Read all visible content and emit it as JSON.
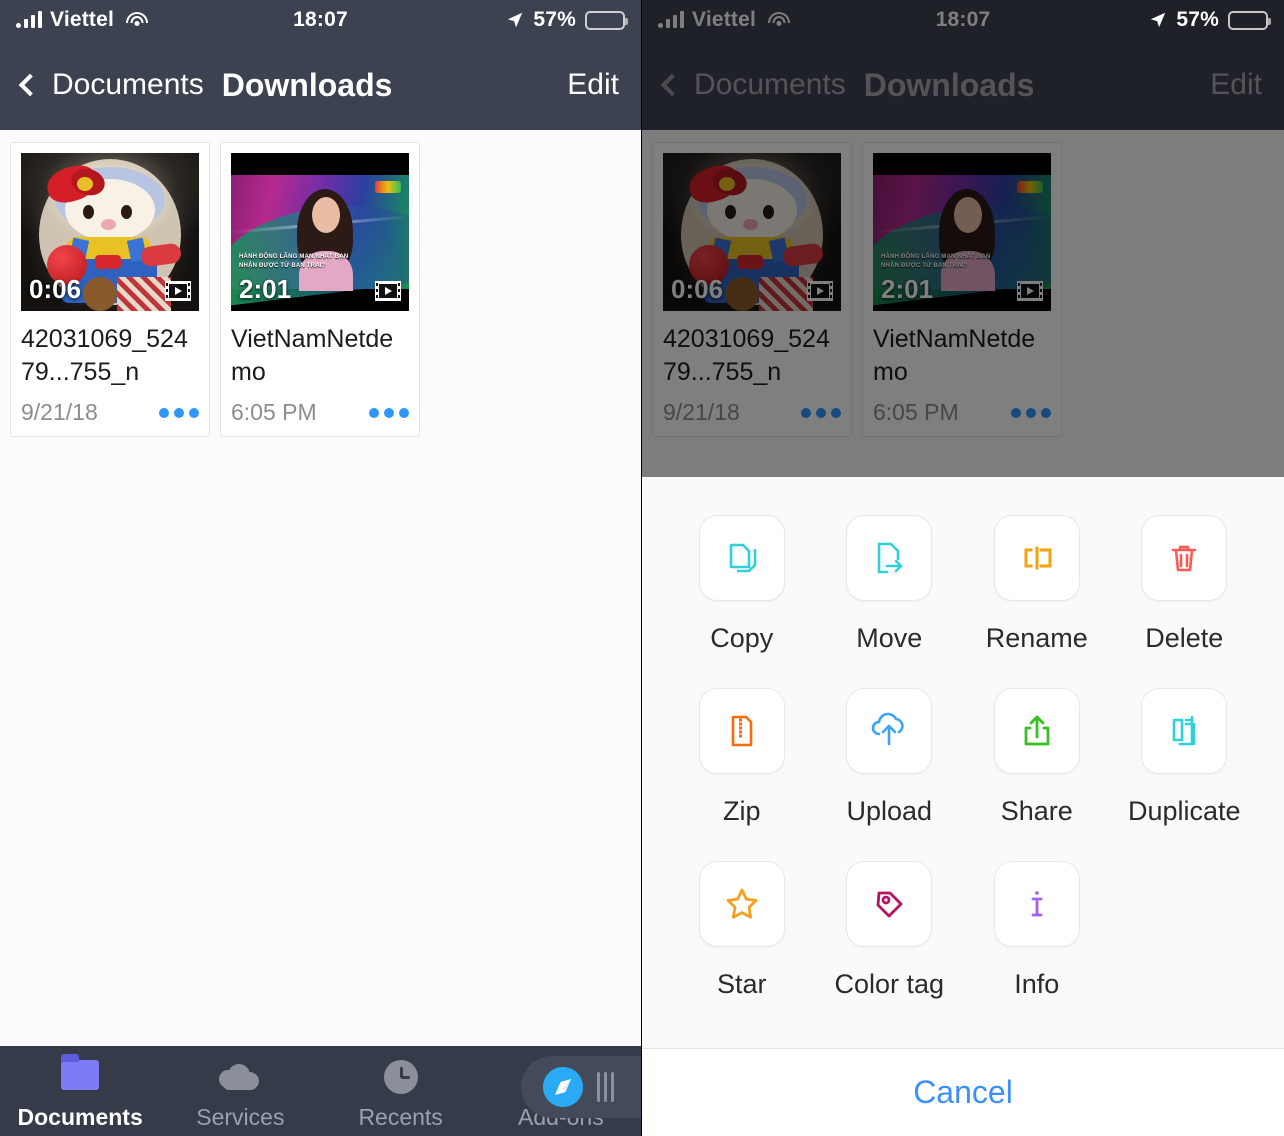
{
  "status_bar": {
    "carrier": "Viettel",
    "time": "18:07",
    "battery_percent": "57%",
    "signal_icon": "cellular-signal-icon",
    "wifi_icon": "wifi-icon",
    "location_icon": "location-arrow-icon",
    "battery_icon": "battery-icon"
  },
  "nav_bar": {
    "back_label": "Documents",
    "title": "Downloads",
    "edit_label": "Edit",
    "back_icon": "chevron-left-icon"
  },
  "files": [
    {
      "name": "42031069_52479...755_n",
      "date": "9/21/18",
      "duration": "0:06",
      "badge_icon": "video-film-icon",
      "more_icon": "more-dots-icon",
      "thumb_kind": "hello-kitty-photo"
    },
    {
      "name": "VietNamNetdemo",
      "date": "6:05 PM",
      "duration": "2:01",
      "badge_icon": "video-film-icon",
      "more_icon": "more-dots-icon",
      "thumb_kind": "vietnamnet-video-frame",
      "thumb_subtitle": "HÀNH ĐỘNG LÃNG MẠN NHẤT BẠN NHẬN ĐƯỢC TỪ BẠN TRAI?"
    }
  ],
  "tab_bar": {
    "items": [
      {
        "label": "Documents",
        "icon": "folder-icon",
        "active": true
      },
      {
        "label": "Services",
        "icon": "cloud-icon",
        "active": false
      },
      {
        "label": "Recents",
        "icon": "clock-icon",
        "active": false
      },
      {
        "label": "Add-ons",
        "icon": "shopping-cart-icon",
        "active": false
      }
    ],
    "browser_button_icon": "safari-compass-icon",
    "drag_handle_icon": "drag-handle-icon"
  },
  "action_sheet": {
    "rows": [
      [
        {
          "label": "Copy",
          "icon": "copy-documents-icon",
          "color": "#2ed1d8"
        },
        {
          "label": "Move",
          "icon": "move-file-arrow-icon",
          "color": "#2ed1d8"
        },
        {
          "label": "Rename",
          "icon": "rename-text-cursor-icon",
          "color": "#f2a20c"
        },
        {
          "label": "Delete",
          "icon": "trash-can-icon",
          "color": "#fb5a53"
        }
      ],
      [
        {
          "label": "Zip",
          "icon": "zip-archive-icon",
          "color": "#f96c0a"
        },
        {
          "label": "Upload",
          "icon": "cloud-upload-icon",
          "color": "#3aa3f5"
        },
        {
          "label": "Share",
          "icon": "share-box-arrow-icon",
          "color": "#36c221"
        },
        {
          "label": "Duplicate",
          "icon": "duplicate-plus-icon",
          "color": "#2ed1d8"
        }
      ],
      [
        {
          "label": "Star",
          "icon": "star-outline-icon",
          "color": "#f7a01e"
        },
        {
          "label": "Color tag",
          "icon": "color-tag-icon",
          "color": "#b51263"
        },
        {
          "label": "Info",
          "icon": "info-text-cursor-icon",
          "color": "#a85ef0"
        }
      ]
    ],
    "cancel_label": "Cancel",
    "cancel_color": "#3b91f7"
  },
  "theme": {
    "nav_bg": "#3c4250",
    "tab_bg": "#353b49",
    "content_bg": "#fbfbfb",
    "accent_blue": "#2f97f7",
    "dim_overlay": "rgba(0,0,0,0.5)"
  }
}
